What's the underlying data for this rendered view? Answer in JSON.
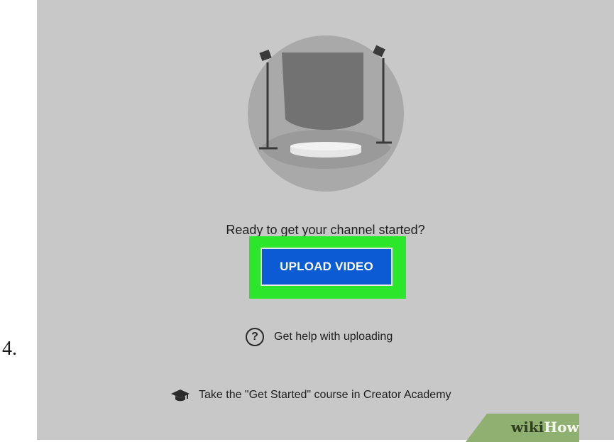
{
  "step": {
    "number": "4."
  },
  "main": {
    "prompt": "Ready to get your channel started?",
    "upload_button_label": "UPLOAD VIDEO",
    "help_link": {
      "icon": "help-circle-icon",
      "label": "Get help with uploading"
    },
    "course_link": {
      "icon": "graduation-cap-icon",
      "label": "Take the \"Get Started\" course in Creator Academy"
    }
  },
  "watermark": {
    "part1": "wiki",
    "part2": "How"
  },
  "colors": {
    "background": "#c8c8c8",
    "button": "#0b5bd4",
    "highlight": "#2ce62c",
    "watermark_bg": "#8fb070"
  }
}
